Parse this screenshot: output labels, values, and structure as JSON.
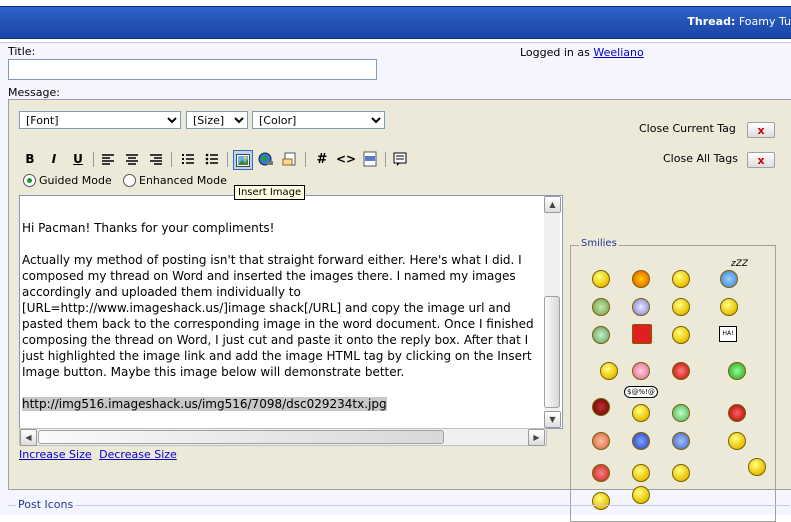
{
  "header": {
    "thread_label": "Thread:",
    "thread_title": "Foamy Tu"
  },
  "form": {
    "title_label": "Title:",
    "message_label": "Message:",
    "logged_in_prefix": "Logged in as",
    "username": "Weeliano"
  },
  "toolbar": {
    "font_select": "[Font]",
    "size_select": "[Size]",
    "color_select": "[Color]",
    "close_current_tag": "Close Current Tag",
    "close_all_tags": "Close All Tags",
    "close_x": "x",
    "guided_mode": "Guided Mode",
    "enhanced_mode": "Enhanced Mode",
    "bold": "B",
    "italic": "I",
    "underline": "U",
    "hash": "#",
    "code": "<>",
    "tooltip": "Insert Image"
  },
  "message": {
    "body": "Hi Pacman! Thanks for your compliments!\n\nActually my method of posting isn't that straight forward either. Here's what I did. I composed my thread on Word and inserted the images there. I named my images accordingly and uploaded them individually to [URL=http://www.imageshack.us/]image shack[/URL] and copy the image url and pasted them back to the corresponding image in the word document. Once I finished composing the thread on Word, I just cut and paste it onto the reply box. After that I just highlighted the image link and add the image HTML tag by clicking on the Insert Image button. Maybe this image below will demonstrate better.\n\n",
    "selected_url": "http://img516.imageshack.us/img516/7098/dsc029234tx.jpg"
  },
  "links": {
    "increase": "Increase Size",
    "decrease": "Decrease Size"
  },
  "smilies": {
    "legend": "Smilies",
    "speech": "$@%!@",
    "sign": "HA!",
    "zzz": "zZZ"
  },
  "post_icons": {
    "legend": "Post Icons"
  },
  "colors": {
    "header_blue": "#1a44a5",
    "editor_bg": "#ece9d8",
    "link": "#0000cc"
  }
}
